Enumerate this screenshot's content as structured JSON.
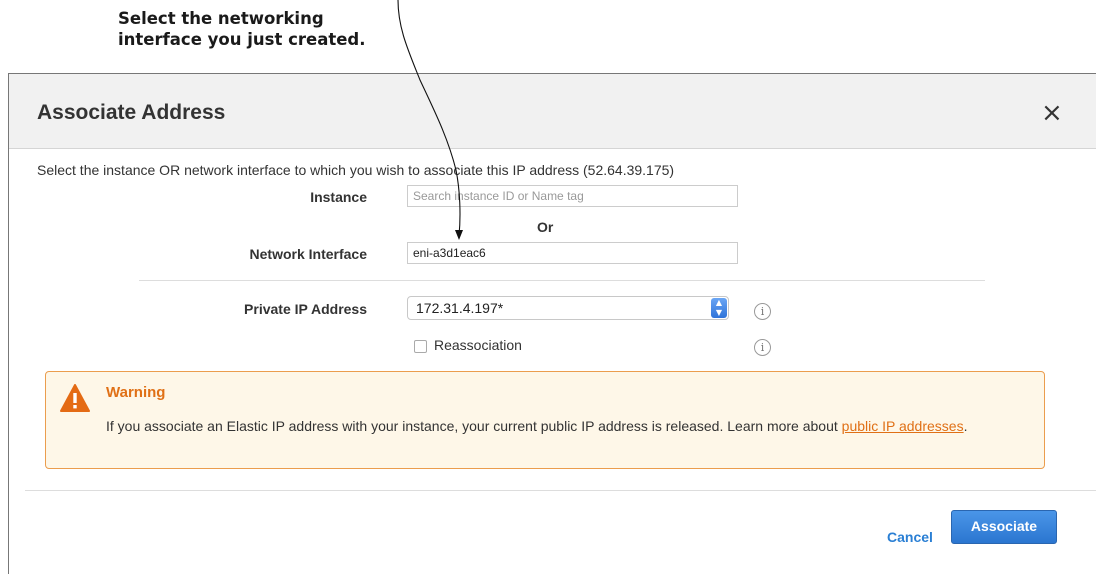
{
  "annotation": {
    "line1": "Select the networking",
    "line2": "interface you just created."
  },
  "dialog": {
    "title": "Associate Address",
    "close_symbol": "×",
    "intro": "Select the instance OR network interface to which you wish to associate this IP address (52.64.39.175)"
  },
  "form": {
    "instance_label": "Instance",
    "instance_placeholder": "Search instance ID or Name tag",
    "instance_value": "",
    "or_label": "Or",
    "network_interface_label": "Network Interface",
    "network_interface_value": "eni-a3d1eac6",
    "private_ip_label": "Private IP Address",
    "private_ip_value": "172.31.4.197*",
    "reassociation_label": "Reassociation",
    "reassociation_checked": false,
    "info_symbol": "i"
  },
  "warning": {
    "title": "Warning",
    "text": "If you associate an Elastic IP address with your instance, your current public IP address is released. Learn more about ",
    "link_text": "public IP addresses",
    "text_end": "."
  },
  "footer": {
    "cancel_label": "Cancel",
    "associate_label": "Associate"
  },
  "colors": {
    "warning_accent": "#e07016",
    "primary_button": "#2b76d0",
    "link": "#2a7fd4"
  }
}
